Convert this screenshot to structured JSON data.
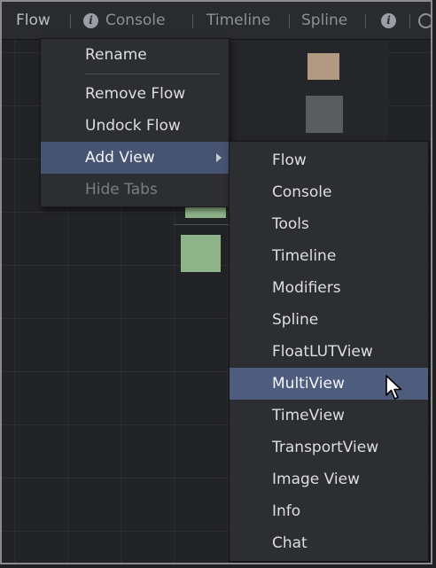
{
  "tabs": [
    {
      "label": "Flow"
    },
    {
      "label": "Console",
      "icon": "info-icon"
    },
    {
      "label": "Timeline"
    },
    {
      "label": "Spline"
    },
    {
      "label": "",
      "icon": "info-icon"
    }
  ],
  "context_menu": {
    "items": [
      {
        "label": "Rename",
        "state": "normal"
      },
      {
        "label": "Remove Flow",
        "state": "normal"
      },
      {
        "label": "Undock Flow",
        "state": "normal"
      },
      {
        "label": "Add View",
        "state": "highlighted",
        "has_submenu": true
      },
      {
        "label": "Hide Tabs",
        "state": "disabled"
      }
    ]
  },
  "add_view_submenu": {
    "items": [
      {
        "label": "Flow"
      },
      {
        "label": "Console"
      },
      {
        "label": "Tools"
      },
      {
        "label": "Timeline"
      },
      {
        "label": "Modifiers"
      },
      {
        "label": "Spline"
      },
      {
        "label": "FloatLUTView"
      },
      {
        "label": "MultiView",
        "state": "highlighted"
      },
      {
        "label": "TimeView"
      },
      {
        "label": "TransportView"
      },
      {
        "label": "Image View"
      },
      {
        "label": "Info"
      },
      {
        "label": "Chat"
      }
    ]
  },
  "colors": {
    "menu_bg": "#2d2e32",
    "highlight": "#465371",
    "swatch_tan": "#b29a82",
    "swatch_gray": "#5b5c5f",
    "swatch_green": "#8fb389"
  }
}
